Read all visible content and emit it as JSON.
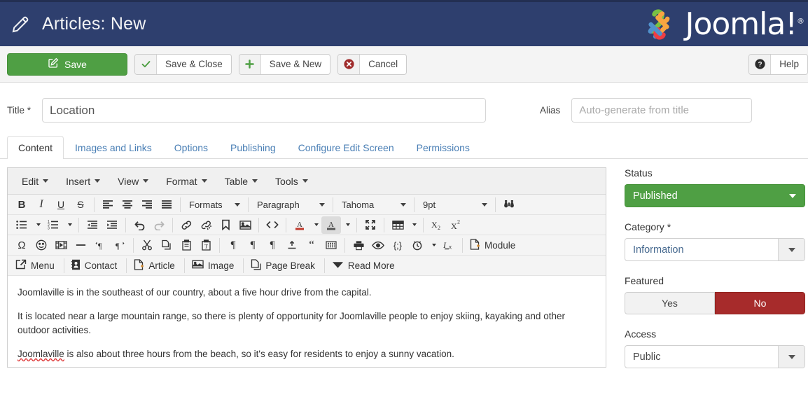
{
  "header": {
    "title": "Articles: New",
    "pencil_icon": "pencil-icon",
    "brand": "Joomla!",
    "brand_reg": "®"
  },
  "toolbar": {
    "save_label": "Save",
    "save_close_label": "Save & Close",
    "save_new_label": "Save & New",
    "cancel_label": "Cancel",
    "help_label": "Help"
  },
  "form": {
    "title_label": "Title *",
    "title_value": "Location",
    "alias_label": "Alias",
    "alias_placeholder": "Auto-generate from title"
  },
  "tabs": [
    {
      "label": "Content"
    },
    {
      "label": "Images and Links"
    },
    {
      "label": "Options"
    },
    {
      "label": "Publishing"
    },
    {
      "label": "Configure Edit Screen"
    },
    {
      "label": "Permissions"
    }
  ],
  "editor": {
    "menubar": [
      "Edit",
      "Insert",
      "View",
      "Format",
      "Table",
      "Tools"
    ],
    "selects": {
      "formats": "Formats",
      "paragraph": "Paragraph",
      "font": "Tahoma",
      "size": "9pt"
    },
    "buttons": {
      "module": "Module",
      "menu": "Menu",
      "contact": "Contact",
      "article": "Article",
      "image": "Image",
      "page_break": "Page Break",
      "read_more": "Read More"
    },
    "content": {
      "p1": "Joomlaville is in the southeast of our country, about a five hour drive from the capital.",
      "p2": "It is located near a large mountain range, so there is plenty of opportunity for Joomlaville people to enjoy skiing, kayaking and other outdoor activities.",
      "p3_misspelled": "Joomlaville",
      "p3_rest": " is also about three hours from the beach, so it's easy for residents to enjoy a sunny vacation."
    }
  },
  "sidebar": {
    "status_label": "Status",
    "status_value": "Published",
    "category_label": "Category *",
    "category_value": "Information",
    "featured_label": "Featured",
    "featured_yes": "Yes",
    "featured_no": "No",
    "access_label": "Access",
    "access_value": "Public"
  },
  "colors": {
    "header_bg": "#2e3f6e",
    "save_green": "#4f9f44",
    "status_green": "#4f9f44",
    "featured_red": "#a72b2b",
    "link_blue": "#4a7fb5"
  }
}
